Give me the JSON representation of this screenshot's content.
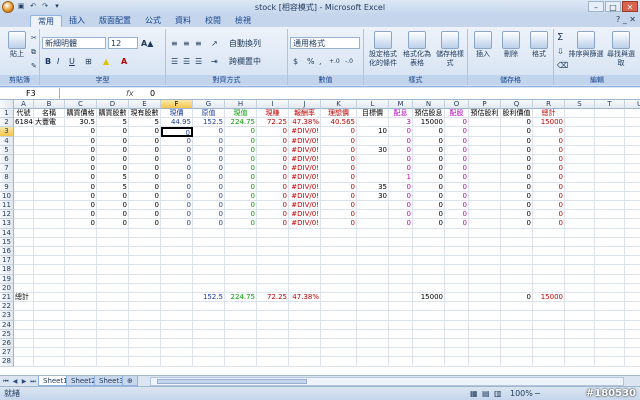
{
  "window": {
    "title": "stock [相容模式] - Microsoft Excel",
    "controls": [
      "–",
      "□",
      "✕"
    ]
  },
  "qat": {
    "save": "▣",
    "undo": "↶",
    "redo": "↷",
    "more": "▾"
  },
  "tabs": [
    "常用",
    "插入",
    "版面配置",
    "公式",
    "資料",
    "校閱",
    "檢視"
  ],
  "help": "? _ ✕",
  "ribbon": {
    "clipboard": {
      "paste_label": "貼上",
      "group_label": "剪貼簿"
    },
    "font": {
      "font_name": "新細明體",
      "font_size": "12",
      "grow": "A▲",
      "shrink": "A▼",
      "bold": "B",
      "italic": "I",
      "underline": "U",
      "fill_icon": "▲",
      "font_color": "A",
      "group_label": "字型"
    },
    "alignment": {
      "wrap": "自動換列",
      "merge": "跨欄置中",
      "group_label": "對齊方式"
    },
    "number": {
      "format": "通用格式",
      "currency": "$",
      "percent": "%",
      "comma": ",",
      "inc": "+.0",
      "dec": "-.0",
      "group_label": "數值"
    },
    "styles": {
      "cond": "設定格式化的條件",
      "table": "格式化為表格",
      "cell": "儲存格樣式",
      "group_label": "樣式"
    },
    "cells": {
      "insert": "插入",
      "delete": "刪除",
      "format": "格式",
      "group_label": "儲存格"
    },
    "editing": {
      "sigma": "Σ",
      "sort": "排序與篩選",
      "find": "尋找與選取",
      "group_label": "編輯"
    }
  },
  "formula_bar": {
    "name_box": "F3",
    "fx": "fx",
    "value": "0"
  },
  "columns": [
    "A",
    "B",
    "C",
    "D",
    "E",
    "F",
    "G",
    "H",
    "I",
    "J",
    "K",
    "L",
    "M",
    "N",
    "O",
    "P",
    "Q",
    "R",
    "S",
    "T",
    "U"
  ],
  "rows": {
    "1": {
      "A": "代號",
      "B": "名稱",
      "C": "購買價格",
      "D": "購買股數",
      "E": "現有股數",
      "F": "現價",
      "G": "原值",
      "H": "現值",
      "I": "現賺",
      "J": "報酬率",
      "K": "理想價",
      "L": "目標價",
      "M": "配息",
      "N": "預估股息",
      "O": "配股",
      "P": "預估股利",
      "Q": "股利價值",
      "R": "總計"
    },
    "2": {
      "A": "6184",
      "B": "大豐電",
      "C": "30.5",
      "D": "5",
      "E": "5",
      "F": "44.95",
      "G": "152.5",
      "H": "224.75",
      "I": "72.25",
      "J": "47.38%",
      "K": "40.565",
      "L": "",
      "M": "3",
      "N": "15000",
      "O": "0",
      "P": "",
      "Q": "0",
      "R": "15000"
    },
    "3": {
      "C": "0",
      "D": "0",
      "E": "0",
      "F": "0",
      "G": "0",
      "H": "0",
      "I": "0",
      "J": "#DIV/0!",
      "K": "0",
      "L": "10",
      "M": "0",
      "N": "0",
      "O": "0",
      "Q": "0",
      "R": "0"
    },
    "4": {
      "C": "0",
      "D": "0",
      "E": "0",
      "F": "0",
      "G": "0",
      "H": "0",
      "I": "0",
      "J": "#DIV/0!",
      "K": "0",
      "L": "",
      "M": "0",
      "N": "0",
      "O": "0",
      "Q": "0",
      "R": "0"
    },
    "5": {
      "C": "0",
      "D": "0",
      "E": "0",
      "F": "0",
      "G": "0",
      "H": "0",
      "I": "0",
      "J": "#DIV/0!",
      "K": "0",
      "L": "30",
      "M": "0",
      "N": "0",
      "O": "0",
      "Q": "0",
      "R": "0"
    },
    "6": {
      "C": "0",
      "D": "0",
      "E": "0",
      "F": "0",
      "G": "0",
      "H": "0",
      "I": "0",
      "J": "#DIV/0!",
      "K": "0",
      "L": "",
      "M": "0",
      "N": "0",
      "O": "0",
      "Q": "0",
      "R": "0"
    },
    "7": {
      "C": "0",
      "D": "0",
      "E": "0",
      "F": "0",
      "G": "0",
      "H": "0",
      "I": "0",
      "J": "#DIV/0!",
      "K": "0",
      "L": "",
      "M": "0",
      "N": "0",
      "O": "0",
      "Q": "0",
      "R": "0"
    },
    "8": {
      "C": "0",
      "D": "5",
      "E": "0",
      "F": "0",
      "G": "0",
      "H": "0",
      "I": "0",
      "J": "#DIV/0!",
      "K": "0",
      "L": "",
      "M": "1",
      "N": "0",
      "O": "0",
      "Q": "0",
      "R": "0"
    },
    "9": {
      "C": "0",
      "D": "5",
      "E": "0",
      "F": "0",
      "G": "0",
      "H": "0",
      "I": "0",
      "J": "#DIV/0!",
      "K": "0",
      "L": "35",
      "M": "0",
      "N": "0",
      "O": "0",
      "Q": "0",
      "R": "0"
    },
    "10": {
      "C": "0",
      "D": "0",
      "E": "0",
      "F": "0",
      "G": "0",
      "H": "0",
      "I": "0",
      "J": "#DIV/0!",
      "K": "0",
      "L": "30",
      "M": "0",
      "N": "0",
      "O": "0",
      "Q": "0",
      "R": "0"
    },
    "11": {
      "C": "0",
      "D": "0",
      "E": "0",
      "F": "0",
      "G": "0",
      "H": "0",
      "I": "0",
      "J": "#DIV/0!",
      "K": "0",
      "L": "",
      "M": "0",
      "N": "0",
      "O": "0",
      "Q": "0",
      "R": "0"
    },
    "12": {
      "C": "0",
      "D": "0",
      "E": "0",
      "F": "0",
      "G": "0",
      "H": "0",
      "I": "0",
      "J": "#DIV/0!",
      "K": "0",
      "L": "",
      "M": "0",
      "N": "0",
      "O": "0",
      "Q": "0",
      "R": "0"
    },
    "13": {
      "C": "0",
      "D": "0",
      "E": "0",
      "F": "0",
      "G": "0",
      "H": "0",
      "I": "0",
      "J": "#DIV/0!",
      "K": "0",
      "L": "",
      "M": "0",
      "N": "0",
      "O": "0",
      "Q": "0",
      "R": "0"
    },
    "21": {
      "A": "總計",
      "G": "152.5",
      "H": "224.75",
      "I": "72.25",
      "J": "47.38%",
      "N": "15000",
      "Q": "0",
      "R": "15000"
    }
  },
  "visible_row_numbers": [
    "1",
    "2",
    "3",
    "4",
    "5",
    "6",
    "7",
    "8",
    "9",
    "10",
    "11",
    "12",
    "13",
    "14",
    "15",
    "16",
    "17",
    "18",
    "19",
    "20",
    "21",
    "22",
    "23",
    "24",
    "25",
    "26",
    "27",
    "28"
  ],
  "colors": {
    "red": "#c00000",
    "green": "#00a000",
    "blue": "#1f3fa0",
    "magenta": "#c000c0",
    "purple": "#7030a0"
  },
  "sheets": [
    "Sheet1",
    "Sheet2",
    "Sheet3"
  ],
  "status": {
    "ready": "就緒",
    "zoom": "100%",
    "zoom_minus": "−",
    "zoom_plus": "+"
  },
  "watermark": "#180530"
}
